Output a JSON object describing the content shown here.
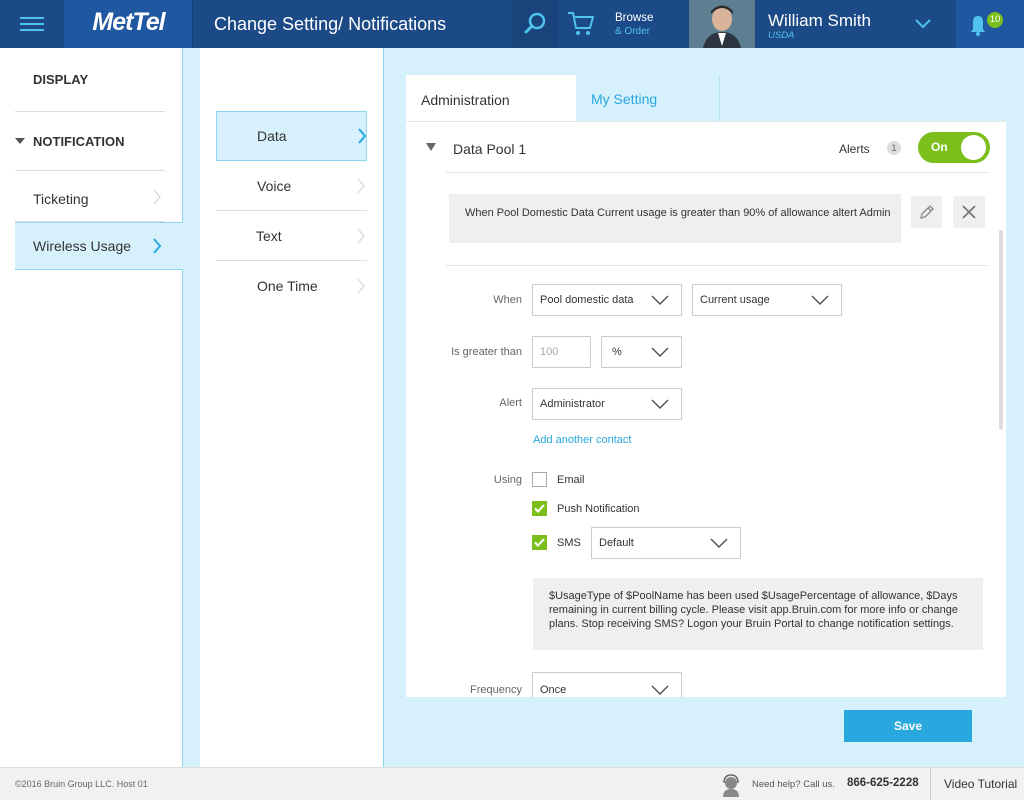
{
  "header": {
    "logo": "MetTel",
    "title": "Change Setting/ Notifications",
    "browse": "Browse",
    "order": "& Order",
    "user_name": "William Smith",
    "user_org": "USDA",
    "notification_count": "10"
  },
  "sidebar": {
    "display": "DISPLAY",
    "notification": "NOTIFICATION",
    "items": [
      {
        "label": "Ticketing",
        "active": false
      },
      {
        "label": "Wireless Usage",
        "active": true
      }
    ]
  },
  "subnav": {
    "items": [
      {
        "label": "Data",
        "active": true
      },
      {
        "label": "Voice",
        "active": false
      },
      {
        "label": "Text",
        "active": false
      },
      {
        "label": "One Time",
        "active": false
      }
    ]
  },
  "tabs": {
    "administration": "Administration",
    "my_setting": "My Setting"
  },
  "pool": {
    "title": "Data Pool 1",
    "alerts_label": "Alerts",
    "alerts_count": "1",
    "toggle_label": "On",
    "summary": "When Pool Domestic Data Current usage is greater than 90% of allowance altert Admin"
  },
  "form": {
    "when_label": "When",
    "when_select1": "Pool domestic data",
    "when_select2": "Current usage",
    "greater_label": "Is greater than",
    "greater_placeholder": "100",
    "unit_select": "%",
    "alert_label": "Alert",
    "alert_select": "Administrator",
    "add_contact": "Add another contact",
    "using_label": "Using",
    "email_label": "Email",
    "email_checked": false,
    "push_label": "Push Notification",
    "push_checked": true,
    "sms_label": "SMS",
    "sms_checked": true,
    "sms_select": "Default",
    "sms_message": "$UsageType of $PoolName has been used $UsagePercentage of allowance, $Days remaining in current billing cycle. Please visit app.Bruin.com for more info or change plans. Stop receiving SMS? Logon your Bruin Portal to change notification settings.",
    "frequency_label": "Frequency",
    "frequency_select": "Once"
  },
  "actions": {
    "save": "Save"
  },
  "footer": {
    "copyright": "©2016 Bruin Group LLC. Host 01",
    "help": "Need help? Call us.",
    "phone": "866-625-2228",
    "video": "Video Tutorial"
  },
  "colors": {
    "header": "#1c4a86",
    "accent": "#29a8df",
    "green": "#7cbf1c",
    "light_blue": "#d6f1fc"
  }
}
